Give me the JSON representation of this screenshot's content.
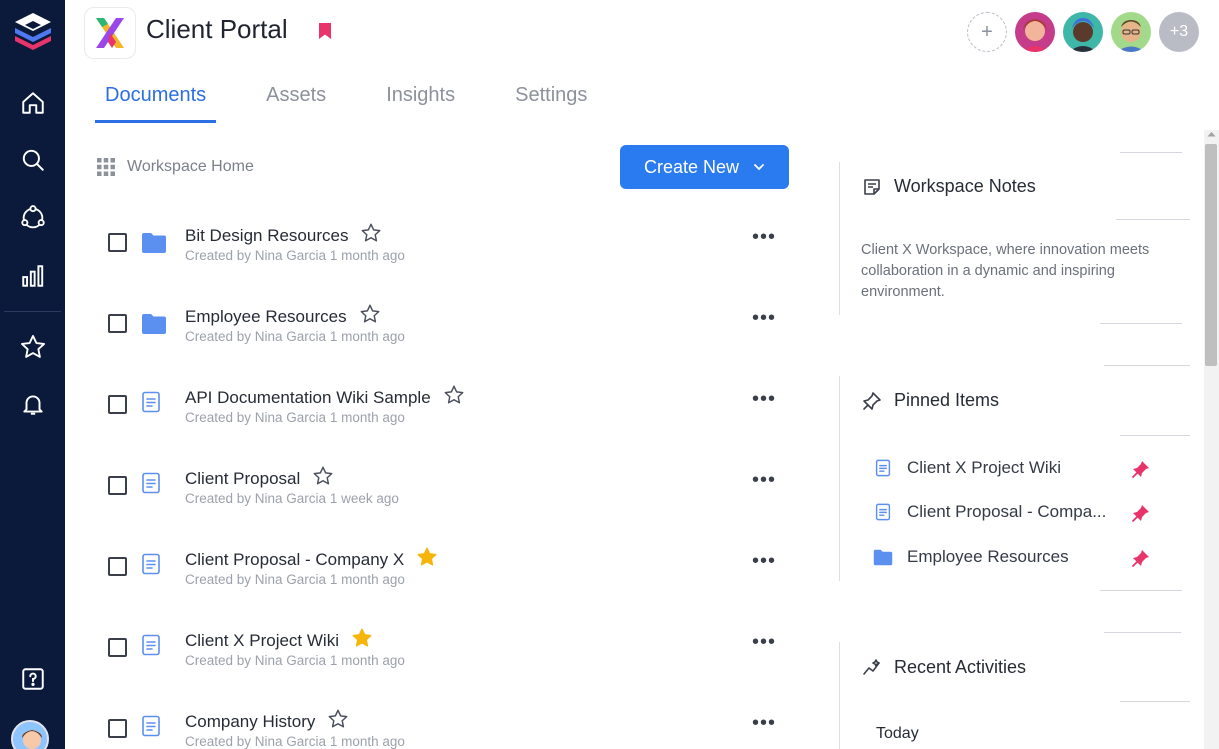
{
  "header": {
    "title": "Client Portal",
    "extra_members": "+3"
  },
  "tabs": [
    {
      "label": "Documents",
      "active": true
    },
    {
      "label": "Assets",
      "active": false
    },
    {
      "label": "Insights",
      "active": false
    },
    {
      "label": "Settings",
      "active": false
    }
  ],
  "toolbar": {
    "breadcrumb": "Workspace Home",
    "create_label": "Create New"
  },
  "documents": [
    {
      "name": "Bit Design Resources",
      "meta": "Created by Nina Garcia 1 month ago",
      "type": "folder",
      "starred": false
    },
    {
      "name": "Employee Resources",
      "meta": "Created by Nina Garcia 1 month ago",
      "type": "folder",
      "starred": false
    },
    {
      "name": "API Documentation Wiki Sample",
      "meta": "Created by Nina Garcia 1 month ago",
      "type": "doc",
      "starred": false
    },
    {
      "name": "Client Proposal",
      "meta": "Created by Nina Garcia 1 week ago",
      "type": "doc",
      "starred": false
    },
    {
      "name": "Client Proposal - Company X",
      "meta": "Created by Nina Garcia 1 month ago",
      "type": "doc",
      "starred": true
    },
    {
      "name": "Client X Project Wiki",
      "meta": "Created by Nina Garcia 1 month ago",
      "type": "doc",
      "starred": true
    },
    {
      "name": "Company History",
      "meta": "Created by Nina Garcia 1 month ago",
      "type": "doc",
      "starred": false
    }
  ],
  "panel": {
    "notes_title": "Workspace Notes",
    "notes_text": "Client X Workspace, where innovation meets collaboration in a dynamic and inspiring environment.",
    "pinned_title": "Pinned Items",
    "pinned": [
      {
        "name": "Client X Project Wiki",
        "type": "doc"
      },
      {
        "name": "Client Proposal - Compa...",
        "type": "doc"
      },
      {
        "name": "Employee Resources",
        "type": "folder"
      }
    ],
    "recent_title": "Recent Activities",
    "recent_group": "Today"
  },
  "colors": {
    "rail": "#0b1a3b",
    "accent": "#2b6fe3",
    "star": "#f5b50a",
    "pin": "#e8336b",
    "folder": "#5b8ff0"
  }
}
